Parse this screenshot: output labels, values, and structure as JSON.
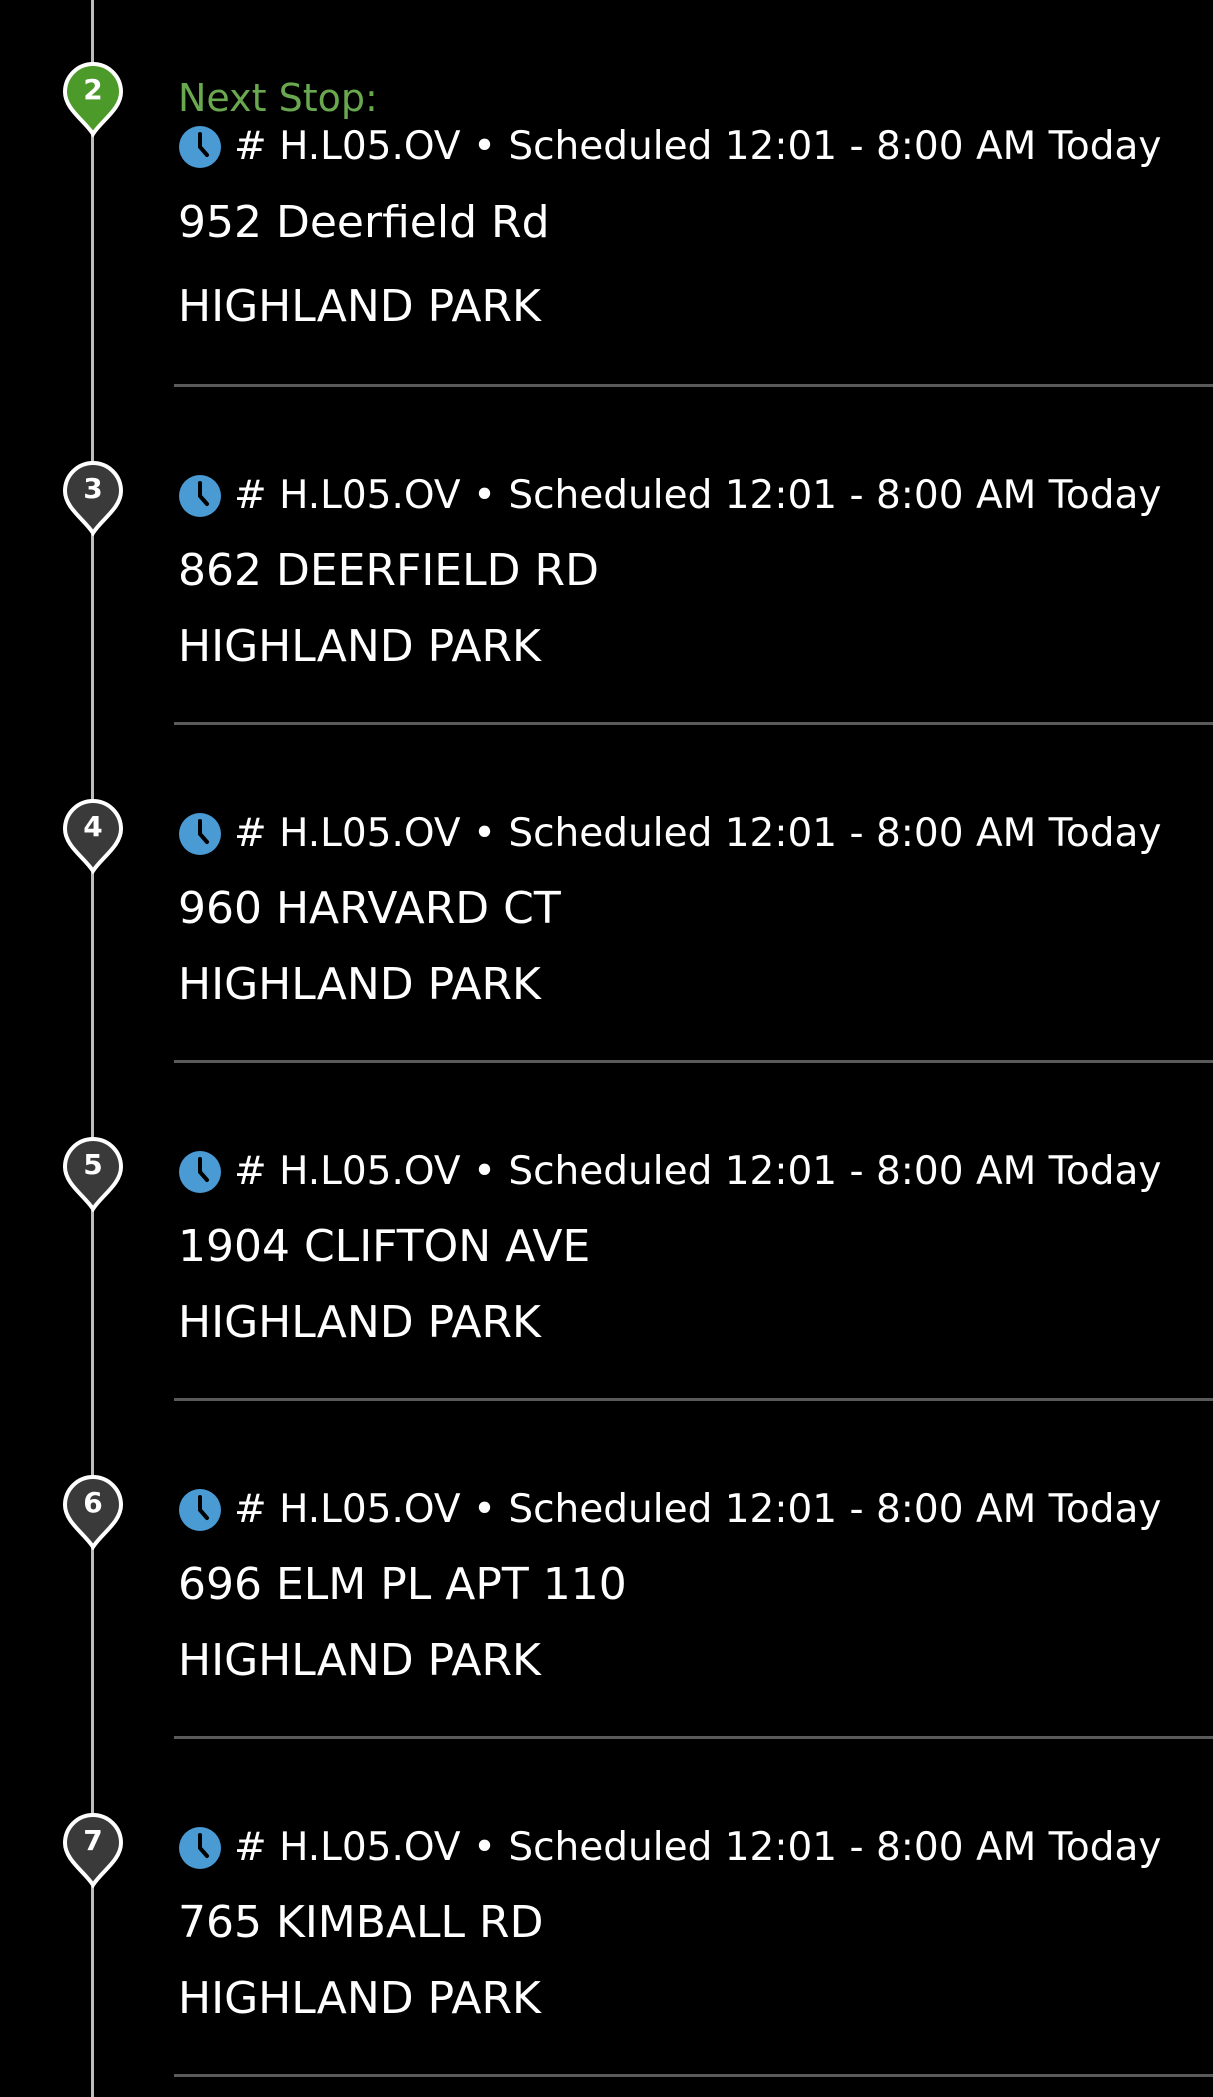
{
  "next_stop_label": "Next Stop:",
  "colors": {
    "next_pin": "#4c9a2a",
    "next_label": "#6aa84f",
    "pin_default": "#3a3a3a",
    "pin_border": "#ffffff",
    "clock": "#4a9ad4",
    "divider": "#5a5a5a",
    "timeline": "#bdbdbd"
  },
  "icons": {
    "pin": "map-pin-icon",
    "clock": "clock-icon"
  },
  "stops": [
    {
      "number": "2",
      "is_next": true,
      "meta": "# H.L05.OV • Scheduled 12:01 - 8:00 AM Today",
      "address": "952 Deerfield Rd",
      "city": "HIGHLAND PARK"
    },
    {
      "number": "3",
      "is_next": false,
      "meta": "# H.L05.OV • Scheduled 12:01 - 8:00 AM Today",
      "address": "862 DEERFIELD RD",
      "city": "HIGHLAND PARK"
    },
    {
      "number": "4",
      "is_next": false,
      "meta": "# H.L05.OV • Scheduled 12:01 - 8:00 AM Today",
      "address": "960 HARVARD CT",
      "city": "HIGHLAND PARK"
    },
    {
      "number": "5",
      "is_next": false,
      "meta": "# H.L05.OV • Scheduled 12:01 - 8:00 AM Today",
      "address": "1904 CLIFTON AVE",
      "city": "HIGHLAND PARK"
    },
    {
      "number": "6",
      "is_next": false,
      "meta": "# H.L05.OV • Scheduled 12:01 - 8:00 AM Today",
      "address": "696 ELM PL APT 110",
      "city": "HIGHLAND PARK"
    },
    {
      "number": "7",
      "is_next": false,
      "meta": "# H.L05.OV • Scheduled 12:01 - 8:00 AM Today",
      "address": "765 KIMBALL RD",
      "city": "HIGHLAND PARK"
    }
  ]
}
